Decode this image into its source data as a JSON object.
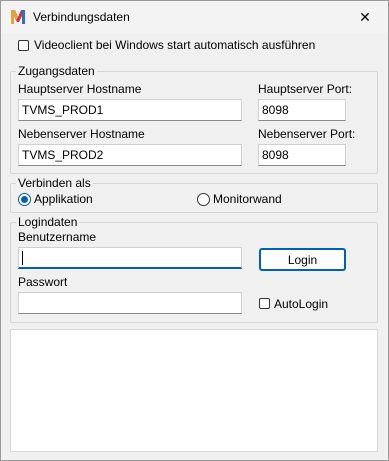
{
  "window": {
    "title": "Verbindungsdaten",
    "close_symbol": "✕"
  },
  "autostart": {
    "label": "Videoclient bei Windows start automatisch ausführen",
    "checked": false
  },
  "access": {
    "group_title": "Zugangsdaten",
    "main_host_label": "Hauptserver Hostname",
    "main_host_value": "TVMS_PROD1",
    "main_port_label": "Hauptserver Port:",
    "main_port_value": "8098",
    "backup_host_label": "Nebenserver Hostname",
    "backup_host_value": "TVMS_PROD2",
    "backup_port_label": "Nebenserver Port:",
    "backup_port_value": "8098"
  },
  "connect_as": {
    "group_title": "Verbinden als",
    "option_app": "Applikation",
    "option_wall": "Monitorwand",
    "selected": "Applikation"
  },
  "login": {
    "group_title": "Logindaten",
    "user_label": "Benutzername",
    "user_value": "",
    "password_label": "Passwort",
    "password_value": "",
    "login_button": "Login",
    "autologin_label": "AutoLogin",
    "autologin_checked": false
  },
  "colors": {
    "accent": "#005fb8",
    "window_bg": "#f0f0f0"
  }
}
